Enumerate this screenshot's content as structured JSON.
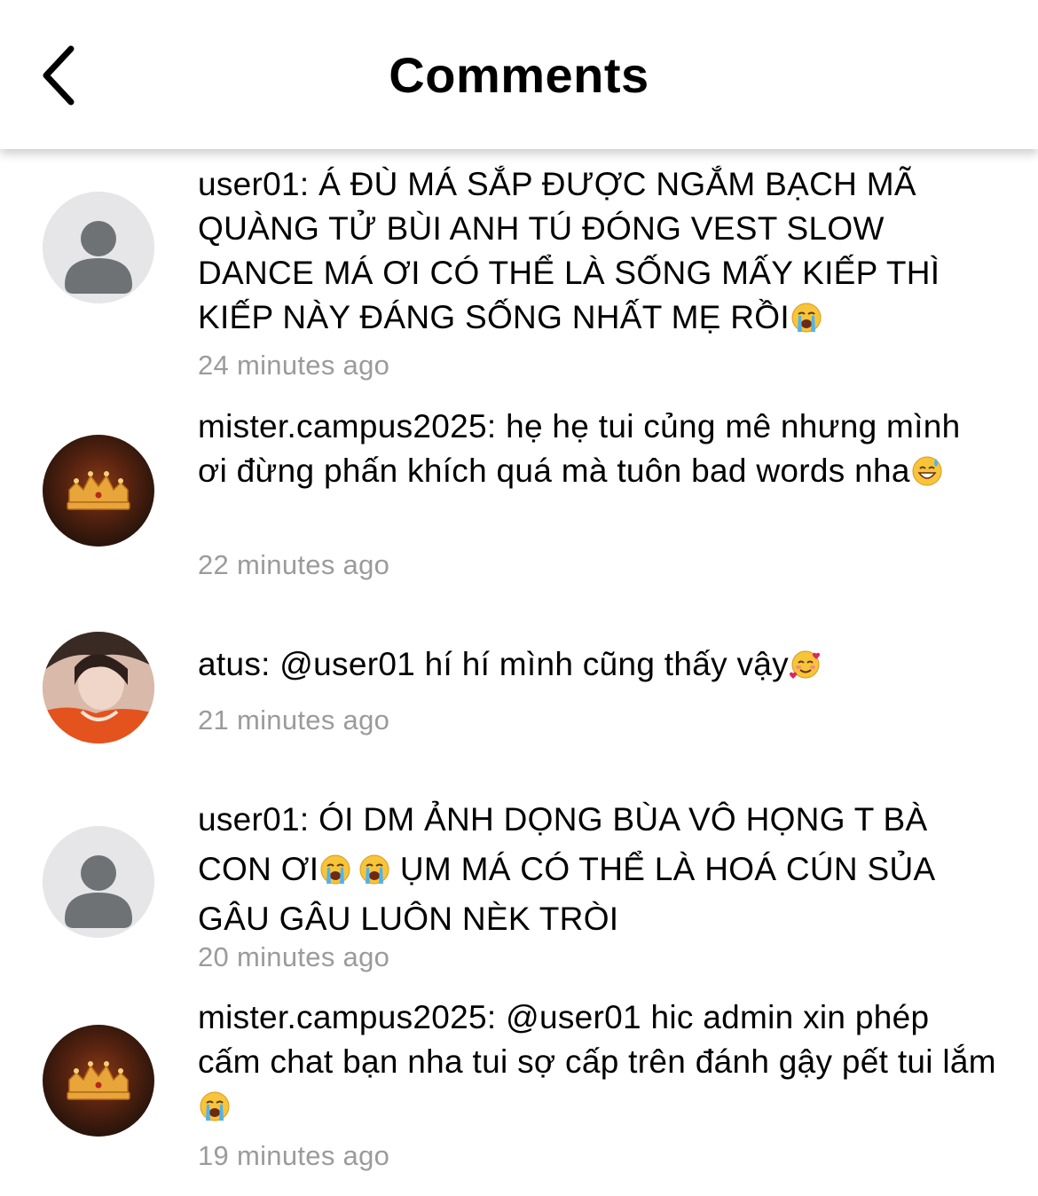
{
  "header": {
    "title": "Comments",
    "back_icon": "chevron-left-icon"
  },
  "comments": [
    {
      "text": "user01: Á ĐÙ MÁ SẮP ĐƯỢC NGẮM BẠCH MÃ QUÀNG TỬ BÙI ANH TÚ ĐÓNG VEST SLOW DANCE MÁ ƠI CÓ THỂ LÀ SỐNG MẤY KIẾP THÌ KIẾP NÀY ĐÁNG SỐNG NHẤT MẸ RỒI",
      "emoji": "loudly-crying-face-emoji",
      "time": "24 minutes ago",
      "avatar": "default-avatar-icon"
    },
    {
      "text": "mister.campus2025: hẹ hẹ tui củng mê nhưng mình ơi đừng phấn khích quá mà tuôn bad words nha",
      "emoji": "grinning-face-with-sweat-emoji",
      "time": "22 minutes ago",
      "avatar": "crown-avatar"
    },
    {
      "text": "atus: @user01 hí hí mình cũng thấy vậy",
      "emoji": "smiling-face-with-hearts-emoji",
      "time": "21 minutes ago",
      "avatar": "photo-avatar"
    },
    {
      "text_a": "user01: ÓI DM ẢNH DỌNG BÙA VÔ HỌNG T BÀ CON ƠI",
      "text_b": " ỤM MÁ CÓ THỂ LÀ HOÁ CÚN SỦA GÂU GÂU LUÔN NÈK TRÒI",
      "emoji": "loudly-crying-face-emoji",
      "time": "20 minutes ago",
      "avatar": "default-avatar-icon"
    },
    {
      "text": "mister.campus2025: @user01 hic admin xin phép cấm chat bạn nha tui sợ cấp trên đánh gậy pết tui lắm",
      "emoji": "loudly-crying-face-emoji",
      "time": "19 minutes ago",
      "avatar": "crown-avatar"
    }
  ]
}
